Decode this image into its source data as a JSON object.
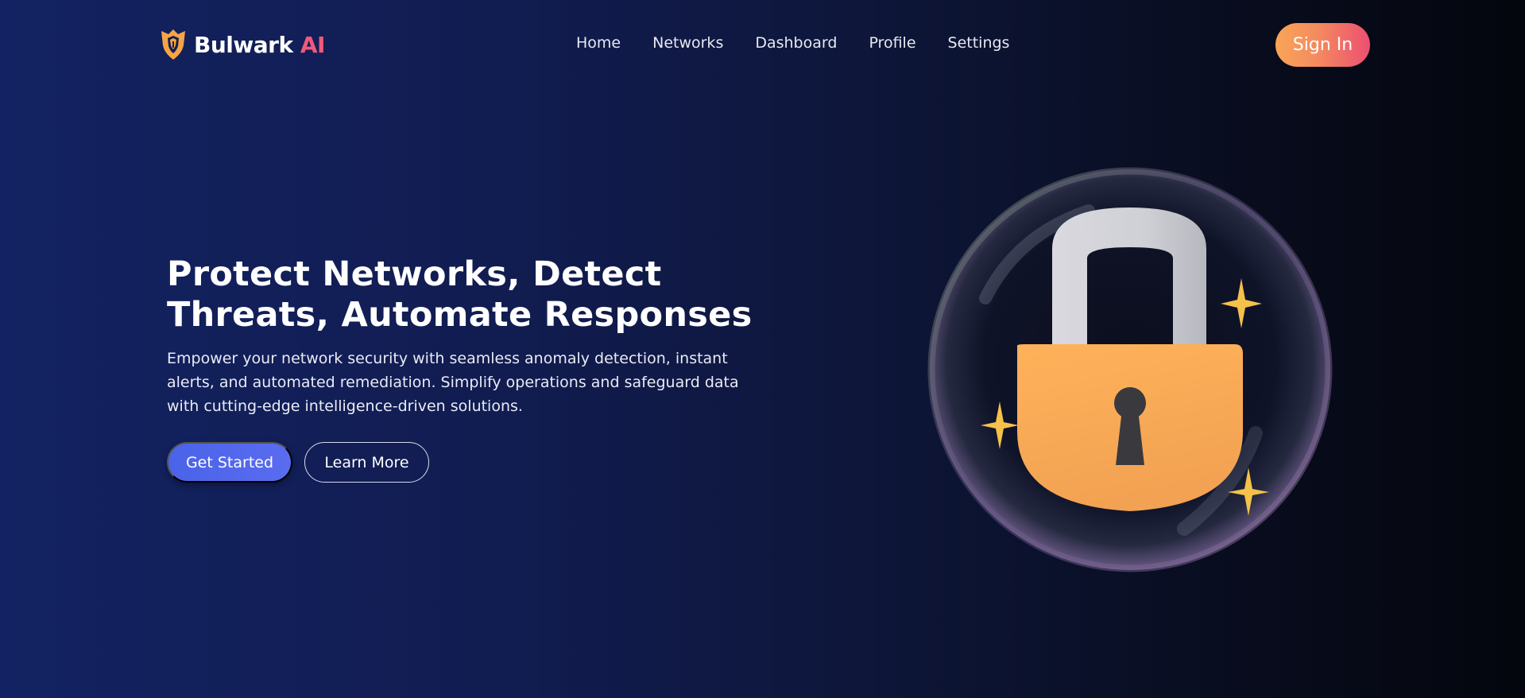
{
  "brand": {
    "name": "Bulwark",
    "suffix": "AI",
    "logo_icon": "shield-icon",
    "accent": "#f0597a"
  },
  "nav": {
    "links": [
      {
        "label": "Home"
      },
      {
        "label": "Networks"
      },
      {
        "label": "Dashboard"
      },
      {
        "label": "Profile"
      },
      {
        "label": "Settings"
      }
    ],
    "signin_label": "Sign In"
  },
  "hero": {
    "headline_line1": "Protect Networks, Detect",
    "headline_line2": "Threats, Automate Responses",
    "description": "Empower your network security with seamless anomaly detection, instant alerts, and automated remediation. Simplify operations and safeguard data with cutting-edge intelligence-driven solutions.",
    "primary_cta": "Get Started",
    "secondary_cta": "Learn More"
  },
  "illustration": {
    "icon": "padlock-icon",
    "decor": "sparkle-icon"
  },
  "colors": {
    "background_start": "#132262",
    "background_end": "#04060d",
    "primary_button": "#4a63e8",
    "signin_gradient_start": "#f9a557",
    "signin_gradient_end": "#ec4f72",
    "lock_body": "#fbaa55"
  }
}
